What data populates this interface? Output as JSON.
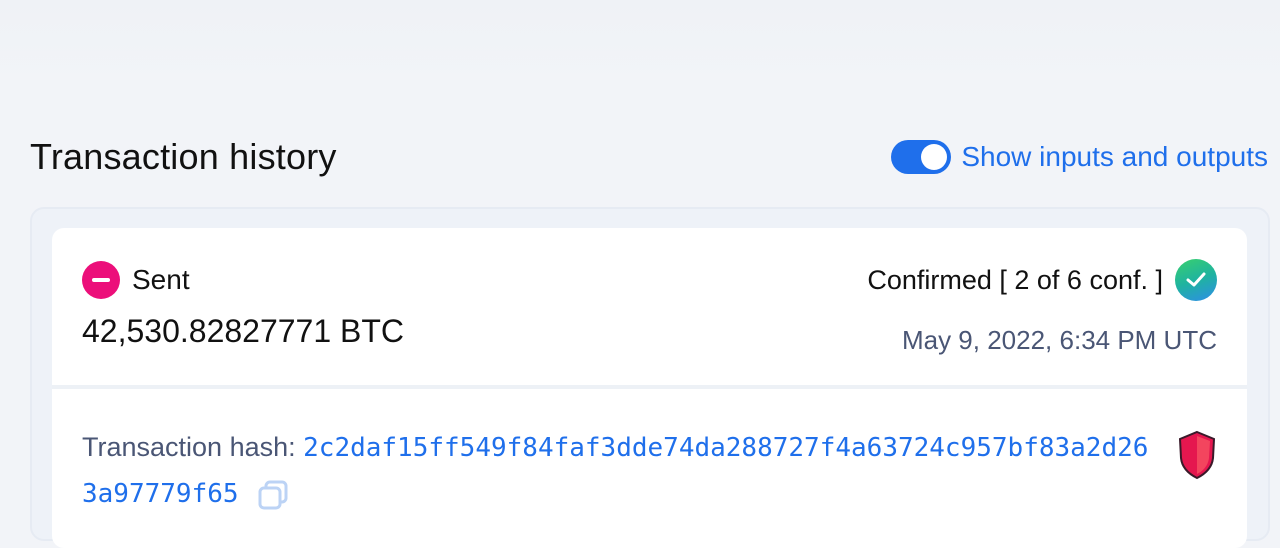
{
  "header": {
    "title": "Transaction history",
    "toggle_label": "Show inputs and outputs",
    "toggle_on": true
  },
  "transaction": {
    "direction_label": "Sent",
    "amount": "42,530.82827771 BTC",
    "status": "Confirmed [ 2 of 6 conf. ]",
    "timestamp": "May 9, 2022, 6:34 PM UTC",
    "hash_label": "Transaction hash:",
    "hash": "2c2daf15ff549f84faf3dde74da288727f4a63724c957bf83a2d263a97779f65"
  },
  "colors": {
    "accent": "#1f6feb",
    "sent": "#ec0f7a",
    "confirmed": "#39d06d",
    "risk": "#e5174f"
  },
  "icons": {
    "direction": "minus-circle-icon",
    "status": "check-circle-icon",
    "copy": "copy-icon",
    "risk": "shield-icon"
  }
}
